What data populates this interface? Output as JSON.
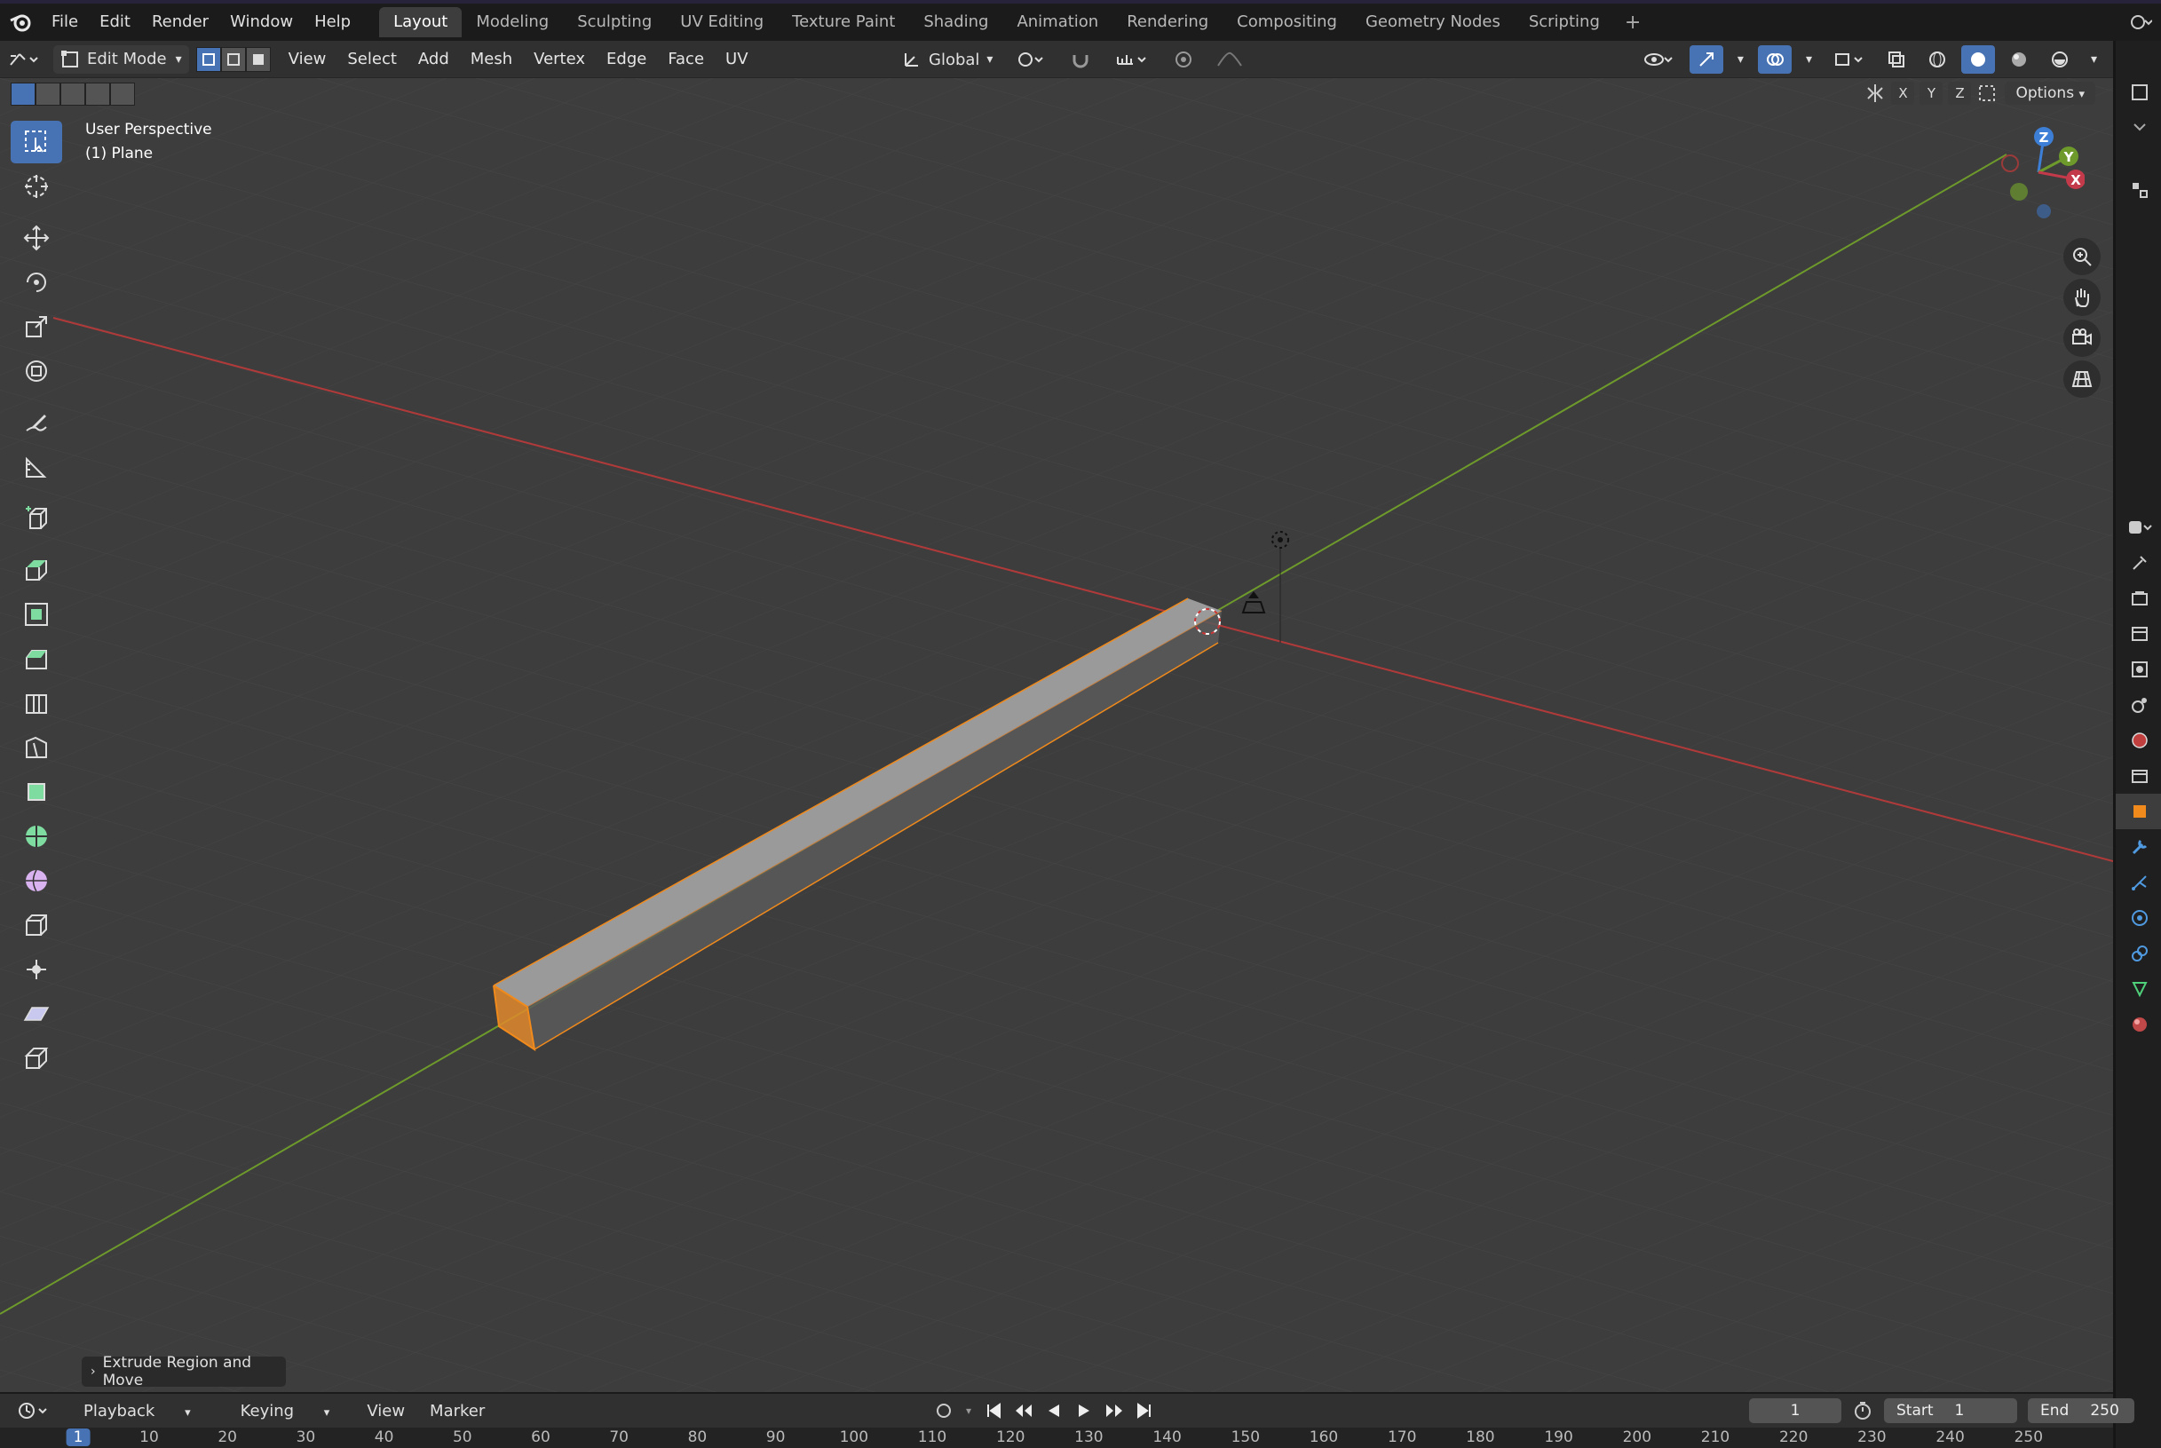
{
  "topbar": {
    "menu": [
      "File",
      "Edit",
      "Render",
      "Window",
      "Help"
    ],
    "workspaces": [
      "Layout",
      "Modeling",
      "Sculpting",
      "UV Editing",
      "Texture Paint",
      "Shading",
      "Animation",
      "Rendering",
      "Compositing",
      "Geometry Nodes",
      "Scripting"
    ],
    "active_workspace": "Layout",
    "add_label": "+"
  },
  "header": {
    "mode": "Edit Mode",
    "menu": [
      "View",
      "Select",
      "Add",
      "Mesh",
      "Vertex",
      "Edge",
      "Face",
      "UV"
    ],
    "orientation": "Global"
  },
  "row2": {
    "axes": [
      "X",
      "Y",
      "Z"
    ],
    "options": "Options"
  },
  "viewport": {
    "perspective": "User Perspective",
    "object": "(1) Plane",
    "gizmo": {
      "z": "Z",
      "y": "Y",
      "x": "X"
    }
  },
  "operator_panel": {
    "label": "Extrude Region and Move"
  },
  "timeline": {
    "menu": [
      "Playback",
      "Keying",
      "View",
      "Marker"
    ],
    "current_frame": "1",
    "start_label": "Start",
    "start": "1",
    "end_label": "End",
    "end": "250",
    "ruler": [
      "1",
      "10",
      "20",
      "30",
      "40",
      "50",
      "60",
      "70",
      "80",
      "90",
      "100",
      "110",
      "120",
      "130",
      "140",
      "150",
      "160",
      "170",
      "180",
      "190",
      "200",
      "210",
      "220",
      "230",
      "240",
      "250"
    ]
  },
  "colors": {
    "accent": "#4772b3",
    "selection": "#f08a1c",
    "x_axis": "#b03a3a",
    "y_axis": "#6e9a2c",
    "z_axis": "#3d7fd6"
  }
}
